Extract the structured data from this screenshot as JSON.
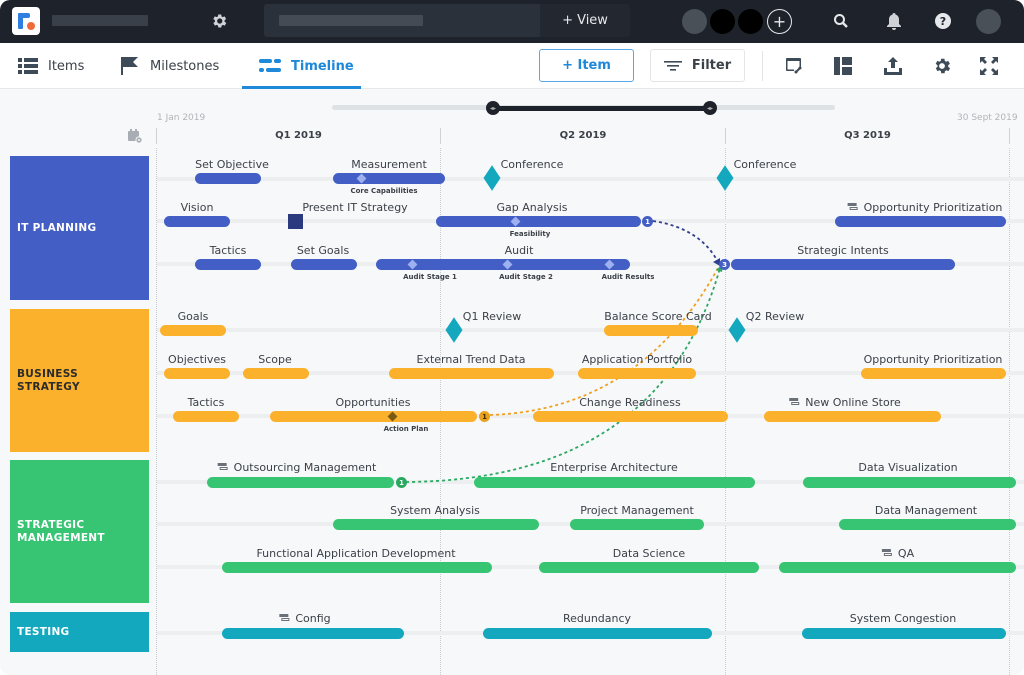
{
  "topbar": {
    "view_button": "+ View",
    "icons": [
      "settings-icon",
      "add-member-icon",
      "search-icon",
      "notifications-icon",
      "help-icon"
    ]
  },
  "toolbar": {
    "tabs": [
      {
        "label": "Items",
        "icon": "list-icon",
        "active": false
      },
      {
        "label": "Milestones",
        "icon": "flag-icon",
        "active": false
      },
      {
        "label": "Timeline",
        "icon": "timeline-icon",
        "active": true
      }
    ],
    "item_button": "+ Item",
    "filter_button": "Filter",
    "tools": [
      "linked-view-icon",
      "layout-icon",
      "export-icon",
      "settings-icon",
      "fullscreen-icon"
    ]
  },
  "colors": {
    "accent": "#1e88d9",
    "it_planning": "#435ec4",
    "business_strategy": "#fbb12c",
    "strategic_management": "#38c573",
    "testing": "#14a8bf",
    "milestone": "#14a8bf"
  },
  "timeline": {
    "start_date": "1 Jan 2019",
    "end_date": "30 Sept 2019",
    "quarters": [
      "Q1 2019",
      "Q2 2019",
      "Q3 2019"
    ],
    "lanes": [
      {
        "name": "IT PLANNING",
        "rows": [
          {
            "items": [
              {
                "label": "Set Objective",
                "type": "bar"
              },
              {
                "label": "Measurement",
                "type": "bar",
                "sub": [
                  "Core Capabilities"
                ]
              },
              {
                "label": "Conference",
                "type": "milestone"
              },
              {
                "label": "Conference",
                "type": "milestone"
              }
            ]
          },
          {
            "items": [
              {
                "label": "Vision",
                "type": "bar"
              },
              {
                "label": "Present IT Strategy",
                "type": "square"
              },
              {
                "label": "Gap Analysis",
                "type": "bar",
                "sub": [
                  "Feasibility"
                ],
                "dependency_count": 1
              },
              {
                "label": "Opportunity Prioritization",
                "type": "bar",
                "linked": true
              }
            ]
          },
          {
            "items": [
              {
                "label": "Tactics",
                "type": "bar"
              },
              {
                "label": "Set Goals",
                "type": "bar"
              },
              {
                "label": "Audit",
                "type": "bar",
                "sub": [
                  "Audit Stage 1",
                  "Audit Stage 2",
                  "Audit Results"
                ]
              },
              {
                "label": "Strategic Intents",
                "type": "bar",
                "dependency_count": 3
              }
            ]
          }
        ]
      },
      {
        "name": "BUSINESS STRATEGY",
        "rows": [
          {
            "items": [
              {
                "label": "Goals",
                "type": "bar"
              },
              {
                "label": "Q1 Review",
                "type": "milestone"
              },
              {
                "label": "Balance Score Card",
                "type": "bar"
              },
              {
                "label": "Q2 Review",
                "type": "milestone"
              }
            ]
          },
          {
            "items": [
              {
                "label": "Objectives",
                "type": "bar"
              },
              {
                "label": "Scope",
                "type": "bar"
              },
              {
                "label": "External Trend Data",
                "type": "bar"
              },
              {
                "label": "Application Portfolio",
                "type": "bar"
              },
              {
                "label": "Opportunity Prioritization",
                "type": "bar"
              }
            ]
          },
          {
            "items": [
              {
                "label": "Tactics",
                "type": "bar"
              },
              {
                "label": "Opportunities",
                "type": "bar",
                "sub": [
                  "Action Plan"
                ],
                "dependency_count": 1
              },
              {
                "label": "Change Readiness",
                "type": "bar"
              },
              {
                "label": "New Online Store",
                "type": "bar",
                "linked": true
              }
            ]
          }
        ]
      },
      {
        "name": "STRATEGIC MANAGEMENT",
        "rows": [
          {
            "items": [
              {
                "label": "Outsourcing Management",
                "type": "bar",
                "linked": true,
                "dependency_count": 1
              },
              {
                "label": "Enterprise Architecture",
                "type": "bar"
              },
              {
                "label": "Data Visualization",
                "type": "bar"
              }
            ]
          },
          {
            "items": [
              {
                "label": "System Analysis",
                "type": "bar"
              },
              {
                "label": "Project Management",
                "type": "bar"
              },
              {
                "label": "Data Management",
                "type": "bar"
              }
            ]
          },
          {
            "items": [
              {
                "label": "Functional Application Development",
                "type": "bar"
              },
              {
                "label": "Data Science",
                "type": "bar"
              },
              {
                "label": "QA",
                "type": "bar",
                "linked": true
              }
            ]
          }
        ]
      },
      {
        "name": "TESTING",
        "rows": [
          {
            "items": [
              {
                "label": "Config",
                "type": "bar",
                "linked": true
              },
              {
                "label": "Redundancy",
                "type": "bar"
              },
              {
                "label": "System Congestion",
                "type": "bar"
              }
            ]
          }
        ]
      }
    ]
  }
}
